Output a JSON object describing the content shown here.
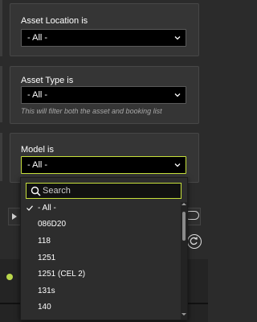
{
  "filters": {
    "asset_location": {
      "label": "Asset Location is",
      "value": "- All -"
    },
    "asset_type": {
      "label": "Asset Type is",
      "value": "- All -",
      "hint": "This will filter both the asset and booking list"
    },
    "model": {
      "label": "Model is",
      "value": "- All -"
    }
  },
  "dropdown": {
    "search_placeholder": "Search",
    "options": [
      {
        "label": "- All -",
        "selected": true
      },
      {
        "label": "086D20",
        "selected": false
      },
      {
        "label": "118",
        "selected": false
      },
      {
        "label": "1251",
        "selected": false
      },
      {
        "label": "1251 (CEL 2)",
        "selected": false
      },
      {
        "label": "131s",
        "selected": false
      },
      {
        "label": "140",
        "selected": false
      }
    ]
  },
  "colors": {
    "accent": "#c6e03b",
    "panel": "#353535",
    "background": "#2b2b2b",
    "status": "#b9d64b"
  },
  "icons": [
    "chevron-down-icon",
    "search-icon",
    "check-icon",
    "play-icon",
    "toggle-icon",
    "refresh-icon",
    "scroll-up-icon",
    "scroll-down-icon"
  ]
}
